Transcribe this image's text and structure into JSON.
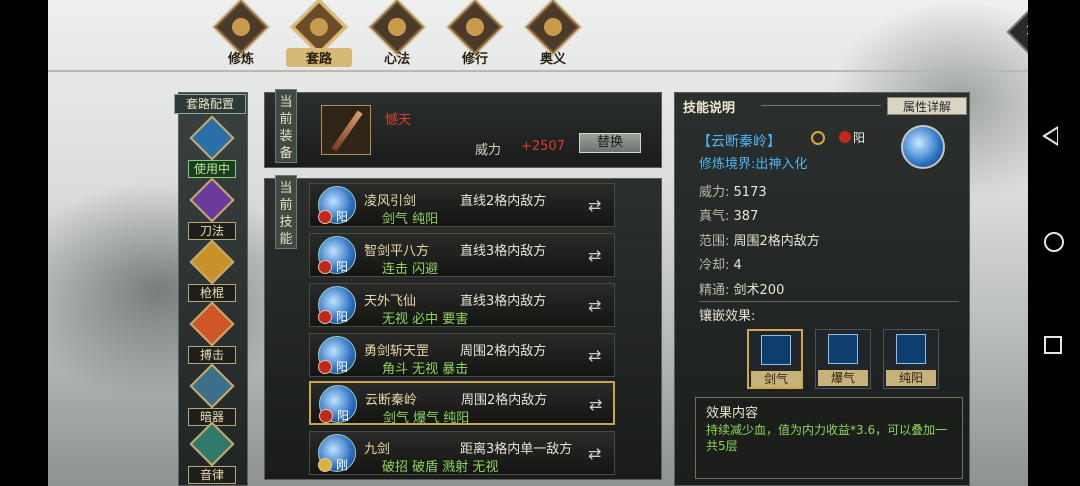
{
  "tabs": [
    {
      "label": "修炼",
      "icon": "xiulian-emblem-icon"
    },
    {
      "label": "套路",
      "icon": "taolu-emblem-icon",
      "active": true
    },
    {
      "label": "心法",
      "icon": "xinfa-emblem-icon"
    },
    {
      "label": "修行",
      "icon": "xiuxing-emblem-icon"
    },
    {
      "label": "奥义",
      "icon": "aoyi-emblem-icon"
    }
  ],
  "category_header": "套路配置",
  "categories": [
    {
      "label": "使用中",
      "icon": "sword-category-icon",
      "active": true
    },
    {
      "label": "刀法",
      "icon": "blade-category-icon"
    },
    {
      "label": "枪棍",
      "icon": "spear-category-icon"
    },
    {
      "label": "搏击",
      "icon": "fist-category-icon"
    },
    {
      "label": "暗器",
      "icon": "hidden-weapon-category-icon"
    },
    {
      "label": "音律",
      "icon": "music-category-icon"
    }
  ],
  "equipment": {
    "section_label": "当前装备",
    "weapon_name": "憾天",
    "power_label": "威力",
    "power_value": "+2507",
    "swap_label": "替换"
  },
  "skills_section_label": "当前技能",
  "skills": [
    {
      "name": "凌风引剑",
      "range": "直线2格内敌方",
      "tags": "剑气 纯阳",
      "element": "阳",
      "badge": "red"
    },
    {
      "name": "智剑平八方",
      "range": "直线3格内敌方",
      "tags": "连击 闪避",
      "element": "阳",
      "badge": "red"
    },
    {
      "name": "天外飞仙",
      "range": "直线3格内敌方",
      "tags": "无视 必中 要害",
      "element": "阳",
      "badge": "red"
    },
    {
      "name": "勇剑斩天罡",
      "range": "周围2格内敌方",
      "tags": "角斗 无视 暴击",
      "element": "阳",
      "badge": "red"
    },
    {
      "name": "云断秦岭",
      "range": "周围2格内敌方",
      "tags": "剑气 爆气 纯阳",
      "element": "阳",
      "badge": "red",
      "active": true
    },
    {
      "name": "九剑",
      "range": "距离3格内单一敌方",
      "tags": "破招 破盾 溅射 无视",
      "element": "刚",
      "badge": "gold"
    }
  ],
  "detail": {
    "title": "技能说明",
    "attr_button": "属性详解",
    "skill_name": "【云断秦岭】",
    "element": "阳",
    "realm": "修炼境界:出神入化",
    "stats": [
      {
        "key": "威力:",
        "value": "5173"
      },
      {
        "key": "真气:",
        "value": "387"
      },
      {
        "key": "范围:",
        "value": "周围2格内敌方"
      },
      {
        "key": "冷却:",
        "value": "4"
      },
      {
        "key": "精通:",
        "value": "剑术200"
      }
    ],
    "inlay_label": "镶嵌效果:",
    "inlays": [
      {
        "label": "剑气",
        "icon": "sword-qi-icon",
        "active": true
      },
      {
        "label": "爆气",
        "icon": "burst-qi-icon"
      },
      {
        "label": "纯阳",
        "icon": "pure-yang-icon"
      }
    ],
    "effect_title": "效果内容",
    "effect_text": "持续减少血，值为内力收益*3.6，可以叠加一共5层"
  }
}
